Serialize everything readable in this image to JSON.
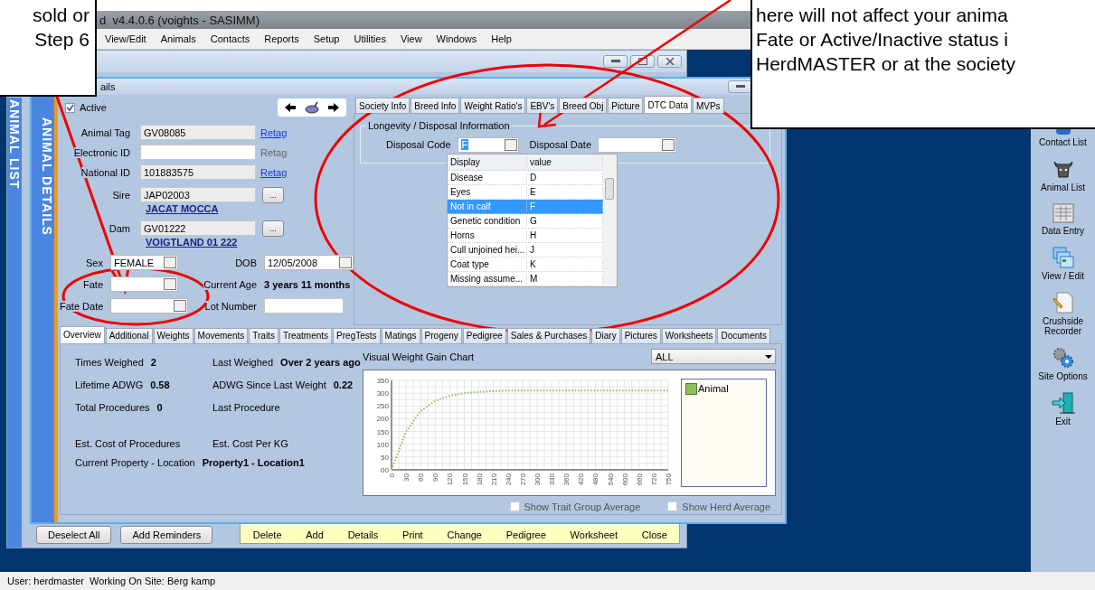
{
  "left_callout": {
    "lines": [
      "sold or",
      "Step 6"
    ]
  },
  "right_callout": {
    "lines": [
      "here will not affect your anima",
      "Fate or Active/Inactive status i",
      "HerdMASTER or at the society"
    ]
  },
  "app_title": "d  v4.4.0.6 (voights - SASIMM)",
  "menu": [
    "View/Edit",
    "Animals",
    "Contacts",
    "Reports",
    "Setup",
    "Utilities",
    "View",
    "Windows",
    "Help"
  ],
  "list_window": {
    "side_label": "ANIMAL LIST",
    "buttons": [
      "Deselect All",
      "Add Reminders"
    ],
    "actions": [
      "Delete",
      "Add",
      "Details",
      "Print",
      "Change",
      "Pedigree",
      "Worksheet",
      "Close"
    ]
  },
  "details_window": {
    "title": "ails",
    "side_label": "ANIMAL DETAILS",
    "active": {
      "label": "Active",
      "checked": true
    },
    "id_fields": [
      {
        "label": "Animal Tag",
        "value": "GV08085",
        "read_only": true,
        "link": "Retag",
        "link_enabled": true
      },
      {
        "label": "Electronic ID",
        "read_only": false,
        "link": "Retag",
        "link_enabled": false
      },
      {
        "label": "National ID",
        "value": "101883575",
        "read_only": true,
        "link": "Retag",
        "link_enabled": true
      }
    ],
    "parents": [
      {
        "label": "Sire",
        "value": "JAP02003",
        "button": "...",
        "name": "JACAT MOCCA"
      },
      {
        "label": "Dam",
        "value": "GV01222",
        "button": "...",
        "name": "VOIGTLAND 01 222"
      }
    ],
    "sex": {
      "label": "Sex",
      "value": "FEMALE"
    },
    "dob": {
      "label": "DOB",
      "value": "12/05/2008"
    },
    "fate": {
      "label": "Fate"
    },
    "current_age": {
      "label": "Current Age",
      "value": "3 years 11 months"
    },
    "fate_date": {
      "label": "Fate Date"
    },
    "lot_number": {
      "label": "Lot Number"
    },
    "info_tabs": [
      {
        "label": "Society Info",
        "selected": false
      },
      {
        "label": "Breed Info",
        "selected": false
      },
      {
        "label": "Weight Ratio's",
        "selected": false
      },
      {
        "label": "EBV's",
        "selected": false
      },
      {
        "label": "Breed Obj",
        "selected": false
      },
      {
        "label": "Picture",
        "selected": false
      },
      {
        "label": "DTC Data",
        "selected": true
      },
      {
        "label": "MVPs",
        "selected": false
      }
    ],
    "disposal": {
      "group_title": "Longevity / Disposal Information",
      "code_label": "Disposal Code",
      "code_value": "F",
      "date_label": "Disposal Date",
      "columns": [
        "Display",
        "value"
      ],
      "rows": [
        {
          "display": "Disease",
          "value": "D",
          "selected": false
        },
        {
          "display": "Eyes",
          "value": "E",
          "selected": false
        },
        {
          "display": "Not in calf",
          "value": "F",
          "selected": true
        },
        {
          "display": "Genetic condition",
          "value": "G",
          "selected": false
        },
        {
          "display": "Horns",
          "value": "H",
          "selected": false
        },
        {
          "display": "Cull unjoined hei...",
          "value": "J",
          "selected": false
        },
        {
          "display": "Coat type",
          "value": "K",
          "selected": false
        },
        {
          "display": "Missing assume...",
          "value": "M",
          "selected": false
        }
      ]
    },
    "record_tabs": [
      {
        "label": "Overview",
        "selected": true
      },
      {
        "label": "Additional",
        "selected": false
      },
      {
        "label": "Weights",
        "selected": false
      },
      {
        "label": "Movements",
        "selected": false
      },
      {
        "label": "Traits",
        "selected": false
      },
      {
        "label": "Treatments",
        "selected": false
      },
      {
        "label": "PregTests",
        "selected": false
      },
      {
        "label": "Matings",
        "selected": false
      },
      {
        "label": "Progeny",
        "selected": false
      },
      {
        "label": "Pedigree",
        "selected": false
      },
      {
        "label": "Sales & Purchases",
        "selected": false
      },
      {
        "label": "Diary",
        "selected": false
      },
      {
        "label": "Pictures",
        "selected": false
      },
      {
        "label": "Worksheets",
        "selected": false
      },
      {
        "label": "Documents",
        "selected": false
      }
    ],
    "overview": {
      "stat_rows": [
        [
          {
            "label": "Times Weighed",
            "value": "2"
          },
          {
            "label": "Last Weighed",
            "value": "Over 2 years ago"
          }
        ],
        [
          {
            "label": "Lifetime ADWG",
            "value": "0.58"
          },
          {
            "label": "ADWG Since Last Weight",
            "value": "0.22"
          }
        ],
        [
          {
            "label": "Total Procedures",
            "value": "0"
          },
          {
            "label": "Last Procedure"
          }
        ],
        [
          {
            "label": "Est. Cost of Procedures"
          },
          {
            "label": "Est. Cost Per KG"
          }
        ],
        [
          {
            "label": "Current Property - Location",
            "value": "Property1 - Location1"
          }
        ]
      ],
      "chart_title": "Visual Weight Gain Chart",
      "filter": "ALL",
      "chart_data": {
        "type": "line",
        "categories": [
          "0",
          "30",
          "60",
          "90",
          "120",
          "150",
          "180",
          "210",
          "240",
          "270",
          "300",
          "330",
          "360",
          "420",
          "480",
          "540",
          "600",
          "660",
          "720",
          "750"
        ],
        "series": [
          {
            "name": "Animal",
            "color": "#8dc05a",
            "values": [
              0,
              150,
              230,
              270,
              290,
              300,
              305,
              308,
              310,
              310,
              310,
              310,
              310,
              310,
              310,
              310,
              310,
              310,
              310,
              310
            ]
          }
        ],
        "grid": true,
        "line_style": "dotted",
        "ylim": [
          0,
          350
        ],
        "yticks": [
          {
            "value": 0,
            "label": "00"
          },
          50,
          100,
          150,
          200,
          250,
          300,
          350
        ]
      },
      "options": [
        {
          "label": "Show Trait Group Average",
          "checked": false
        },
        {
          "label": "Show Herd Average",
          "checked": false
        }
      ]
    }
  },
  "toolbar": [
    {
      "kind": "contacts",
      "label": "Contact List"
    },
    {
      "kind": "animals",
      "label": "Animal List"
    },
    {
      "kind": "data-entry",
      "label": "Data Entry"
    },
    {
      "kind": "view-edit",
      "label": "View / Edit"
    },
    {
      "kind": "recorder",
      "label": "Crushside Recorder"
    },
    {
      "kind": "options",
      "label": "Site Options"
    },
    {
      "kind": "exit",
      "label": "Exit"
    }
  ],
  "status_bar": {
    "user": "User: herdmaster",
    "site": "Working On Site: Berg kamp"
  }
}
